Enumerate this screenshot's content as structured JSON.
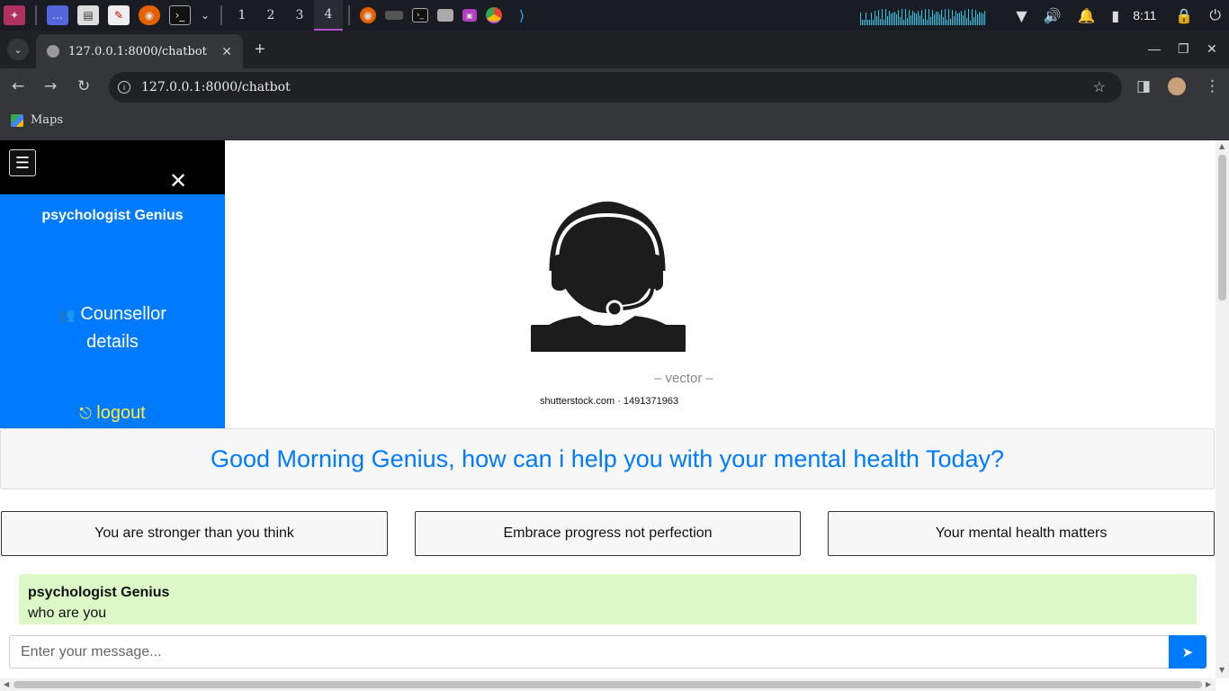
{
  "taskbar": {
    "workspaces": [
      "1",
      "2",
      "3",
      "4"
    ],
    "active_workspace": "4",
    "clock": "8:11"
  },
  "browser": {
    "tab_title": "127.0.0.1:8000/chatbot",
    "url": "127.0.0.1:8000/chatbot",
    "bookmark_label": "Maps"
  },
  "sidebar": {
    "brand": "psychologist Genius",
    "counsellor_label": "Counsellor details",
    "logout_label": "logout"
  },
  "hero": {
    "vector_caption": "– vector –",
    "stock_caption": "shutterstock.com · 1491371963"
  },
  "greeting": "Good Morning Genius, how can i help you with your mental health Today?",
  "quotes": [
    "You are stronger than you think",
    "Embrace progress not perfection",
    "Your mental health matters"
  ],
  "messages": [
    {
      "sender": "psychologist Genius",
      "text": "who are you"
    }
  ],
  "chat_input": {
    "placeholder": "Enter your message..."
  },
  "colors": {
    "primary": "#007bff",
    "message_bg": "#dcf8c6",
    "logout": "#ffeb3b"
  }
}
